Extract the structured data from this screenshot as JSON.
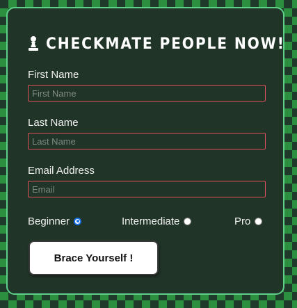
{
  "form": {
    "title": "CHECKMATE PEOPLE NOW!",
    "title_icon": "chess-pawn-icon",
    "first_name": {
      "label": "First Name",
      "placeholder": "First Name",
      "value": ""
    },
    "last_name": {
      "label": "Last Name",
      "placeholder": "Last Name",
      "value": ""
    },
    "email": {
      "label": "Email Address",
      "placeholder": "Email",
      "value": ""
    },
    "levels": [
      {
        "label": "Beginner",
        "checked": true
      },
      {
        "label": "Intermediate",
        "checked": false
      },
      {
        "label": "Pro",
        "checked": false
      }
    ],
    "submit_label": "Brace Yourself !"
  },
  "colors": {
    "card_background": "#213428",
    "card_border": "#5fd08a",
    "input_border": "#e25060",
    "radio_accent": "#1a73e8",
    "pattern_green": "#2b8f3f"
  }
}
